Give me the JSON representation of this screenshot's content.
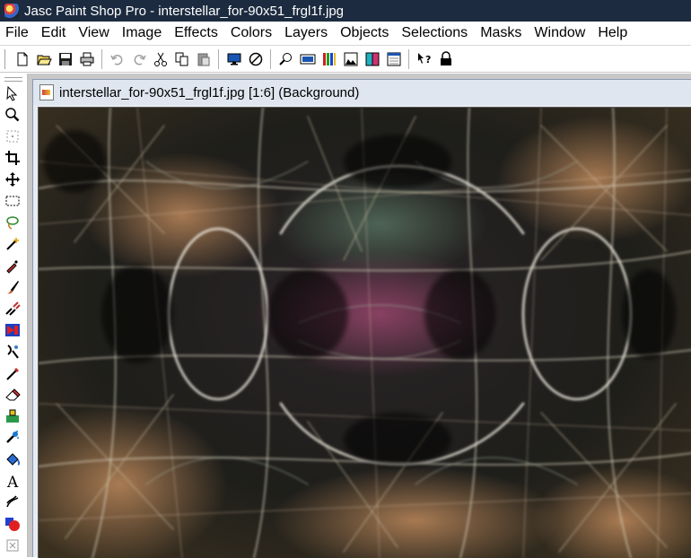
{
  "window": {
    "title": "Jasc Paint Shop Pro - interstellar_for-90x51_frgl1f.jpg"
  },
  "menu": {
    "items": [
      "File",
      "Edit",
      "View",
      "Image",
      "Effects",
      "Colors",
      "Layers",
      "Objects",
      "Selections",
      "Masks",
      "Window",
      "Help"
    ]
  },
  "toolbar": {
    "buttons": [
      "new-icon",
      "open-icon",
      "save-icon",
      "print-icon",
      "undo-icon",
      "redo-icon",
      "cut-icon",
      "copy-icon",
      "paste-icon",
      "full-screen-preview-icon",
      "browse-icon",
      "zoom-icon",
      "toolbar-toggle-icon",
      "histogram-icon",
      "layers-palette-icon",
      "overview-icon",
      "color-palette-icon",
      "context-help-icon",
      "lock-icon"
    ]
  },
  "tools": [
    "arrow-icon",
    "zoom-tool-icon",
    "deform-icon",
    "crop-icon",
    "mover-icon",
    "selection-icon",
    "freehand-selection-icon",
    "magic-wand-icon",
    "dropper-icon",
    "paint-brush-icon",
    "clone-brush-icon",
    "color-replacer-icon",
    "retouch-icon",
    "scratch-remover-icon",
    "eraser-icon",
    "picture-tube-icon",
    "airbrush-icon",
    "flood-fill-icon",
    "text-icon",
    "draw-icon",
    "preset-shapes-icon",
    "vector-object-selection-icon"
  ],
  "document": {
    "title": "interstellar_for-90x51_frgl1f.jpg [1:6] (Background)",
    "image_description_name": "fractal-lattice-image"
  },
  "colors": {
    "titlebar": "#1c2b3f",
    "doc_title_bg": "#dfe6ef"
  }
}
